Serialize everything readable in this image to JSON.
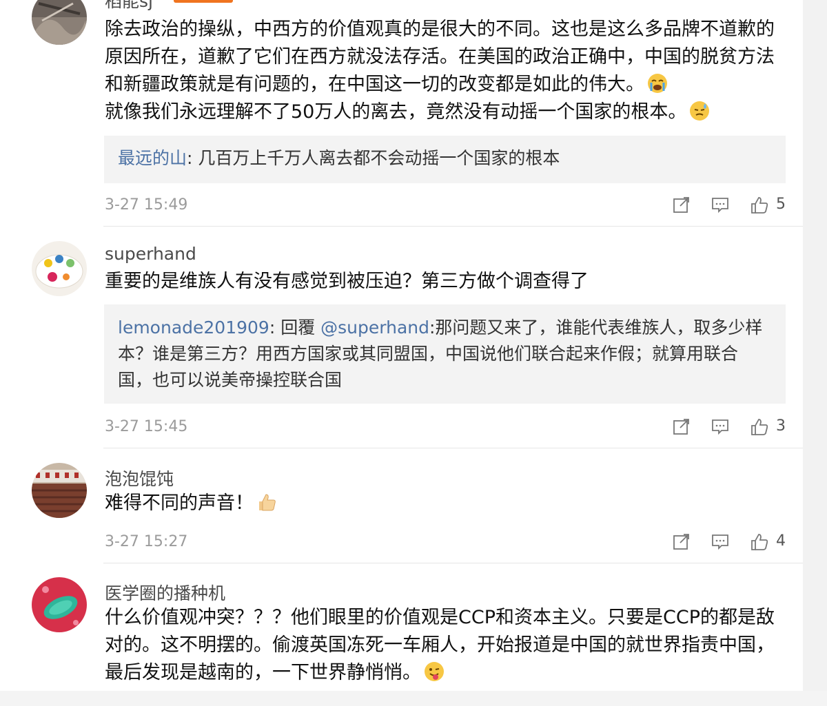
{
  "comments": [
    {
      "username": "稻能sj",
      "text": "除去政治的操纵，中西方的价值观真的是很大的不同。这也是这么多品牌不道歉的原因所在，道歉了它们在西方就没法存活。在美国的政治正确中，中国的脱贫方法和新疆政策就是有问题的，在中国这一切的改变都是如此的伟大。",
      "text2": "就像我们永远理解不了50万人的离去，竟然没有动摇一个国家的根本。",
      "emoji1": "crying-face-emoji",
      "emoji2": "sweat-face-emoji",
      "reply": {
        "author": "最远的山",
        "separator": ": ",
        "text": "几百万上千万人离去都不会动摇一个国家的根本"
      },
      "time": "3-27 15:49",
      "likes": "5"
    },
    {
      "username": "superhand",
      "text": "重要的是维族人有没有感觉到被压迫？第三方做个调查得了",
      "reply": {
        "author": "lemonade201909",
        "separator": ": ",
        "prefix": "回覆 ",
        "mention": "@superhand",
        "text": ":那问题又来了，谁能代表维族人，取多少样本？谁是第三方？用西方国家或其同盟国，中国说他们联合起来作假；就算用联合国，也可以说美帝操控联合国"
      },
      "time": "3-27 15:45",
      "likes": "3"
    },
    {
      "username": "泡泡馄饨",
      "text": "难得不同的声音！",
      "emoji1": "thumbs-up-emoji",
      "time": "3-27 15:27",
      "likes": "4"
    },
    {
      "username": "医学圈的播种机",
      "text": "什么价值观冲突？？？他们眼里的价值观是CCP和资本主义。只要是CCP的都是敌对的。这不明摆的。偷渡英国冻死一车厢人，开始报道是中国的就世界指责中国，最后发现是越南的，一下世界静悄悄。",
      "emoji1": "tongue-wink-emoji"
    }
  ],
  "colors": {
    "accent": "#f0741f",
    "link": "#4c72a5",
    "meta": "#9b9b9b"
  }
}
